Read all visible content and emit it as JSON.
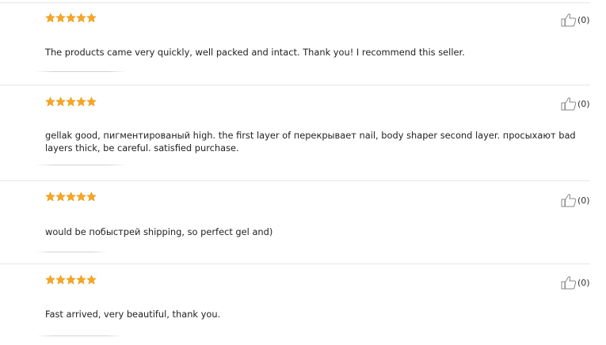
{
  "reviews": [
    {
      "rating": 5,
      "text": "The products came very quickly, well packed and intact. Thank you! I recommend this seller.",
      "helpful_count": "(0)"
    },
    {
      "rating": 5,
      "text": "gellak good, пигментированый high. the first layer of перекрывает nail, body shaper second layer. просыхают bad layers thick, be careful. satisfied purchase.",
      "helpful_count": "(0)"
    },
    {
      "rating": 5,
      "text": "would be побыстрей shipping, so perfect gel and)",
      "helpful_count": "(0)"
    },
    {
      "rating": 5,
      "text": "Fast arrived, very beautiful, thank you.",
      "helpful_count": "(0)"
    }
  ],
  "icons": {
    "star": "star-icon",
    "helpful": "thumbs-up-icon"
  },
  "colors": {
    "star": "#f5a623",
    "star_outline": "#e08e0b",
    "divider": "#e6e6e6",
    "text": "#222222"
  }
}
